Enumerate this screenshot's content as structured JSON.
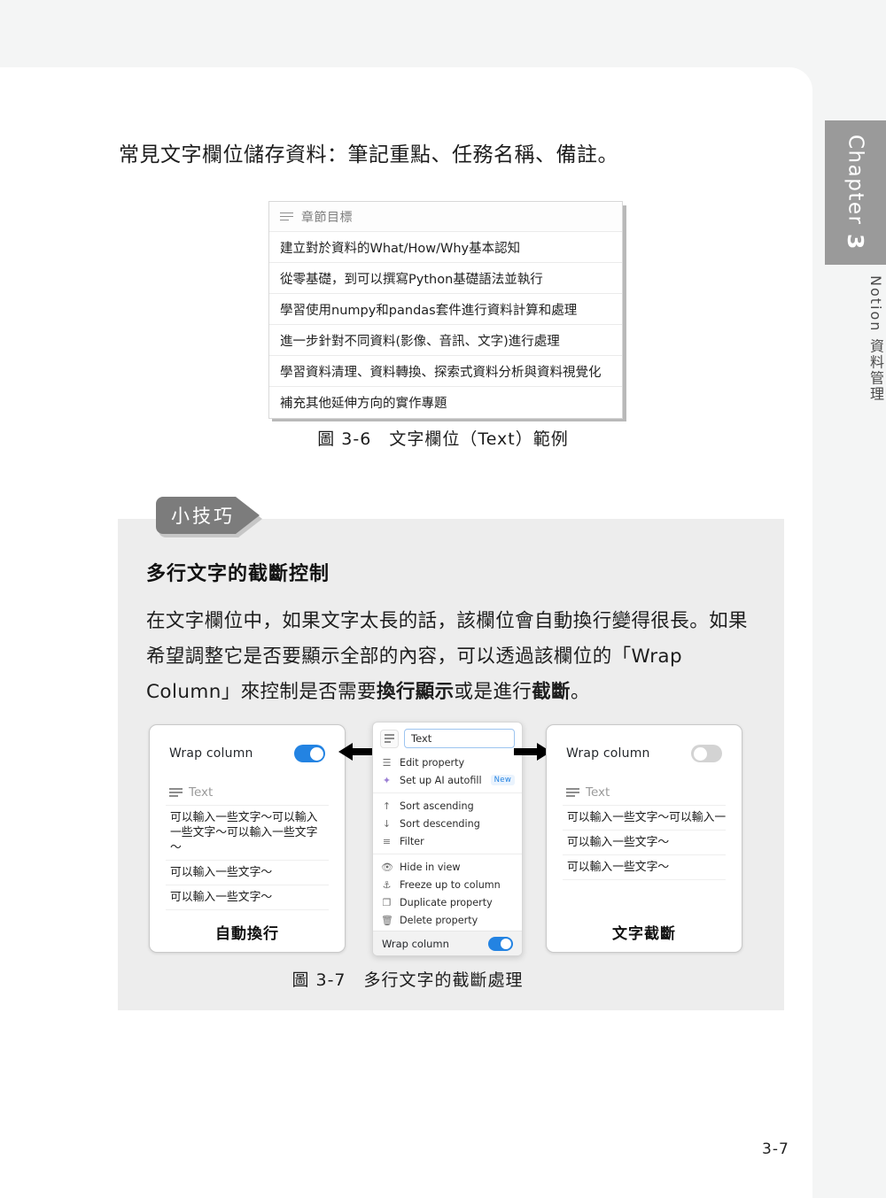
{
  "page": {
    "number": "3-7",
    "intro_line": "常見文字欄位儲存資料：筆記重點、任務名稱、備註。"
  },
  "rail": {
    "chapter_word": "Chapter",
    "chapter_number": "3",
    "chapter_title": "Notion 資料管理",
    "tab_color": "#9a9a9a"
  },
  "figure_36": {
    "caption": "圖 3-6　文字欄位（Text）範例",
    "table": {
      "header_icon": "text-lines-icon",
      "header_label": "章節目標",
      "rows": [
        "建立對於資料的What/How/Why基本認知",
        "從零基礎，到可以撰寫Python基礎語法並執行",
        "學習使用numpy和pandas套件進行資料計算和處理",
        "進一步針對不同資料(影像、音訊、文字)進行處理",
        "學習資料清理、資料轉換、探索式資料分析與資料視覺化",
        "補充其他延伸方向的實作專題"
      ]
    }
  },
  "tip": {
    "flag_label": "小技巧",
    "title": "多行文字的截斷控制",
    "paragraph_part1": "在文字欄位中，如果文字太長的話，該欄位會自動換行變得很長。如果希望調整它是否要顯示全部的內容，可以透過該欄位的「Wrap Column」來控制是否需要",
    "paragraph_bold1": "換行顯示",
    "paragraph_part2": "或是進行",
    "paragraph_bold2": "截斷",
    "paragraph_part3": "。"
  },
  "figure_37": {
    "caption": "圖 3-7　多行文字的截斷處理",
    "panel_left": {
      "toggle_label": "Wrap column",
      "toggle_state": "on",
      "toggle_color": "#2383e2",
      "column_icon": "text-lines-icon",
      "column_label": "Text",
      "cells": [
        "可以輸入一些文字～可以輸入一些文字～可以輸入一些文字～",
        "可以輸入一些文字～",
        "可以輸入一些文字～"
      ],
      "footer_label": "自動換行"
    },
    "panel_right": {
      "toggle_label": "Wrap column",
      "toggle_state": "off",
      "toggle_color": "#d3d3d3",
      "column_icon": "text-lines-icon",
      "column_label": "Text",
      "cells": [
        "可以輸入一些文字～可以輸入一",
        "可以輸入一些文字～",
        "可以輸入一些文字～"
      ],
      "footer_label": "文字截斷"
    },
    "menu": {
      "input_value": "Text",
      "input_placeholder": "Text",
      "type_icon": "text-lines-icon",
      "group1": [
        {
          "icon": "list-icon",
          "label": "Edit property"
        },
        {
          "icon": "sparkle-icon",
          "label": "Set up AI autofill",
          "badge": "New"
        }
      ],
      "group2": [
        {
          "icon": "arrow-up-icon",
          "label": "Sort ascending"
        },
        {
          "icon": "arrow-down-icon",
          "label": "Sort descending"
        },
        {
          "icon": "filter-icon",
          "label": "Filter"
        }
      ],
      "group3": [
        {
          "icon": "eye-hidden-icon",
          "label": "Hide in view"
        },
        {
          "icon": "pin-icon",
          "label": "Freeze up to column"
        },
        {
          "icon": "duplicate-icon",
          "label": "Duplicate property"
        },
        {
          "icon": "trash-icon",
          "label": "Delete property"
        }
      ],
      "footer": {
        "label": "Wrap column",
        "toggle_state": "on",
        "toggle_color": "#2383e2"
      }
    },
    "arrow_left": "arrow-left-icon",
    "arrow_right": "arrow-right-icon"
  }
}
